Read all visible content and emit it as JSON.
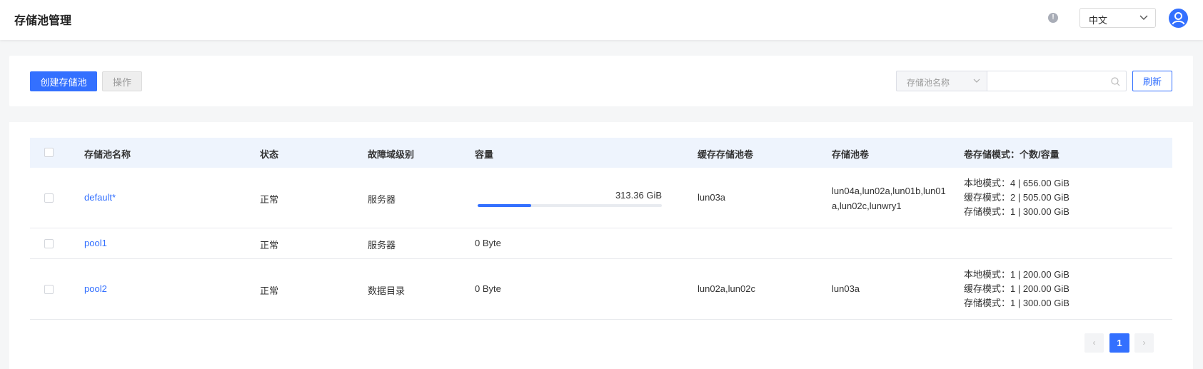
{
  "header": {
    "title": "存储池管理",
    "info_icon": "info-icon",
    "language": "中文",
    "avatar_icon": "user-avatar-icon"
  },
  "toolbar": {
    "create_label": "创建存储池",
    "action_label": "操作",
    "filter_field": "存储池名称",
    "search_placeholder": "",
    "refresh_label": "刷新"
  },
  "table": {
    "columns": [
      "存储池名称",
      "状态",
      "故障域级别",
      "容量",
      "缓存存储池卷",
      "存储池卷",
      "卷存储模式：个数/容量"
    ],
    "rows": [
      {
        "name": "default*",
        "status": "正常",
        "fault_domain": "服务器",
        "capacity": "313.36 GiB",
        "capacity_used_fraction": 0.29,
        "cache_volumes": "lun03a",
        "volumes": "lun04a,lun02a,lun01b,lun01a,lun02c,lunwry1",
        "modes": [
          "本地模式：4 | 656.00 GiB",
          "缓存模式：2 | 505.00 GiB",
          "存储模式：1 | 300.00 GiB"
        ]
      },
      {
        "name": "pool1",
        "status": "正常",
        "fault_domain": "服务器",
        "capacity": "0 Byte",
        "cache_volumes": "",
        "volumes": "",
        "modes": []
      },
      {
        "name": "pool2",
        "status": "正常",
        "fault_domain": "数据目录",
        "capacity": "0 Byte",
        "cache_volumes": "lun02a,lun02c",
        "volumes": "lun03a",
        "modes": [
          "本地模式：1 | 200.00 GiB",
          "缓存模式：1 | 200.00 GiB",
          "存储模式：1 | 300.00 GiB"
        ]
      }
    ]
  },
  "pagination": {
    "current_page": "1",
    "prev": "‹",
    "next": "›"
  },
  "colors": {
    "primary": "#3370ff",
    "header_bg": "#eef4fd",
    "page_bg": "#f5f6f7"
  }
}
